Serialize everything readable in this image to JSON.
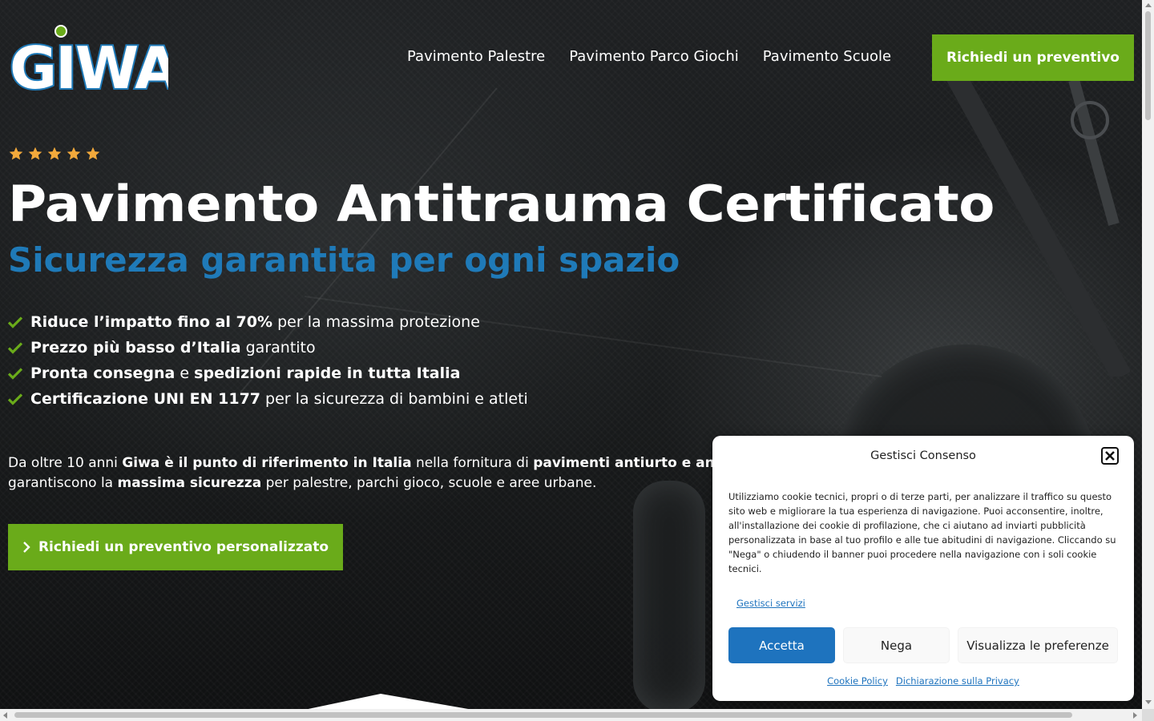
{
  "brand": {
    "logo_text": "GIWA",
    "accent_green": "#6aab1a",
    "accent_blue": "#1f7ab8"
  },
  "nav": {
    "items": [
      {
        "label": "Pavimento Palestre"
      },
      {
        "label": "Pavimento Parco Giochi"
      },
      {
        "label": "Pavimento Scuole"
      }
    ],
    "cta_label": "Richiedi un preventivo"
  },
  "hero": {
    "rating_stars": 5,
    "title": "Pavimento Antitrauma Certificato",
    "subtitle": "Sicurezza garantita per ogni spazio",
    "features": [
      {
        "bold": "Riduce l’impatto fino al 70%",
        "rest": " per la massima protezione"
      },
      {
        "bold": "Prezzo più basso d’Italia",
        "rest": " garantito"
      },
      {
        "bold": "Pronta consegna",
        "mid": " e ",
        "bold2": "spedizioni rapide in tutta Italia",
        "rest": ""
      },
      {
        "bold": "Certificazione UNI EN 1177",
        "rest": " per la sicurezza di bambini e atleti"
      }
    ],
    "intro": {
      "p1": "Da oltre 10 anni ",
      "b1": "Giwa è il punto di riferimento in Italia",
      "p2": " nella fornitura di ",
      "b2": "pavimenti antiurto e antitrauma certificati",
      "p3": " che garantiscono la ",
      "b3": "massima sicurezza",
      "p4": " per palestre, parchi gioco, scuole e aree urbane."
    },
    "cta_label": "Richiedi un preventivo personalizzato"
  },
  "cookie": {
    "title": "Gestisci Consenso",
    "text": "Utilizziamo cookie tecnici, propri o di terze parti, per analizzare il traffico su questo sito web e migliorare la tua esperienza di navigazione. Puoi acconsentire, inoltre, all'installazione dei cookie di profilazione, che ci aiutano ad inviarti pubblicità personalizzata in base al tuo profilo e alle tue abitudini di navigazione. Cliccando su \"Nega\" o chiudendo il banner puoi procedere nella navigazione con i soli cookie tecnici.",
    "manage_label": "Gestisci servizi",
    "accept_label": "Accetta",
    "deny_label": "Nega",
    "prefs_label": "Visualizza le preferenze",
    "links": [
      {
        "label": "Cookie Policy"
      },
      {
        "label": "Dichiarazione sulla Privacy"
      }
    ],
    "accent": "#1e73be"
  }
}
